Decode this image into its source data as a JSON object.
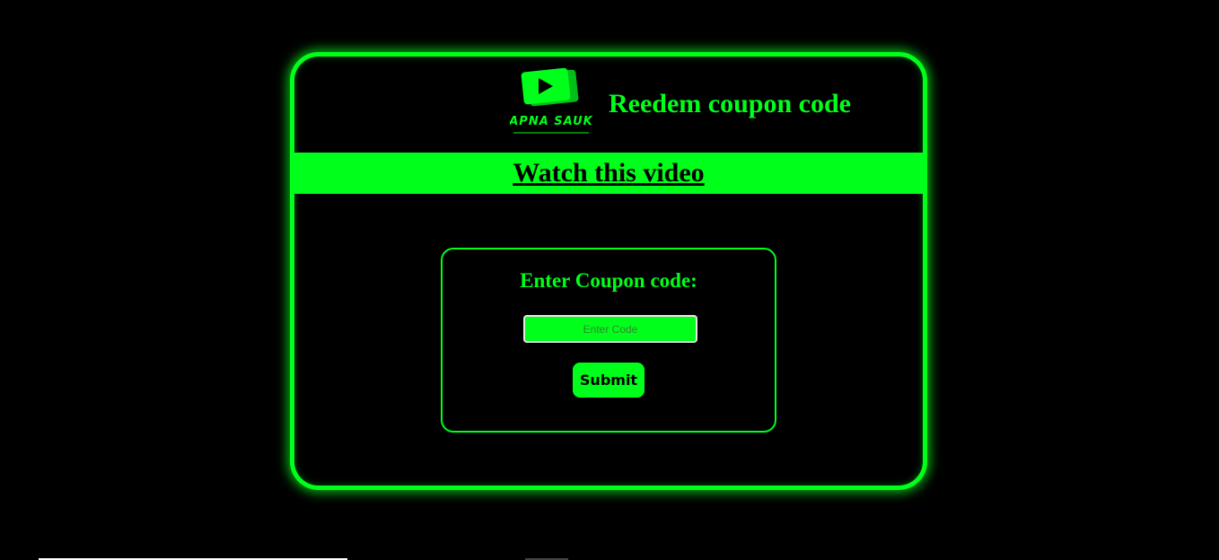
{
  "header": {
    "logo_text": "APNA SAUK",
    "title": "Reedem coupon code"
  },
  "video": {
    "link_label": "Watch this video"
  },
  "coupon": {
    "label": "Enter Coupon code:",
    "input_placeholder": "Enter Code",
    "input_value": "",
    "submit_label": "Submit"
  },
  "colors": {
    "accent": "#00ff1a",
    "background": "#000000"
  }
}
